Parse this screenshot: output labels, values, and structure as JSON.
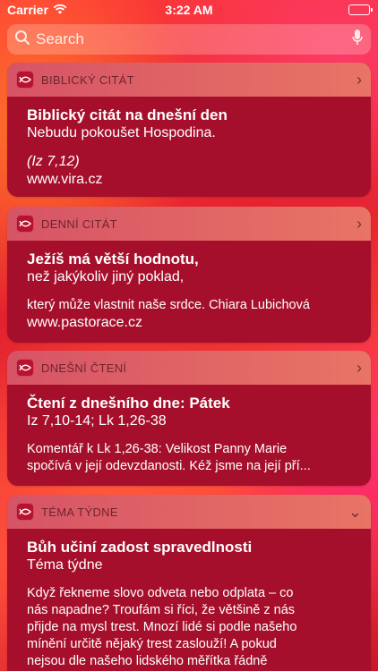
{
  "status": {
    "carrier": "Carrier",
    "time": "3:22 AM"
  },
  "search": {
    "placeholder": "Search"
  },
  "widgets": [
    {
      "title": "BIBLICKÝ CITÁT",
      "chevron": "›",
      "headline": "Biblický citát na dnešní den",
      "line1": "Nebudu pokoušet Hospodina.",
      "reference": "(Iz 7,12)",
      "source": "www.vira.cz"
    },
    {
      "title": "DENNÍ CITÁT",
      "chevron": "›",
      "headline1": "Ježíš má větší hodnotu,",
      "headline2": "než jakýkoliv jiný poklad,",
      "line1": "který může vlastnit naše srdce. Chiara Lubichová",
      "source": "www.pastorace.cz"
    },
    {
      "title": "DNEŠNÍ ČTENÍ",
      "chevron": "›",
      "headline": "Čtení z dnešního dne: Pátek",
      "line1": "Iz 7,10-14; Lk 1,26-38",
      "comment1": "Komentář k Lk 1,26-38: Velikost Panny Marie",
      "comment2": "spočívá v její odevzdanosti. Kéž jsme na její pří..."
    },
    {
      "title": "TÉMA TÝDNE",
      "chevron": "⌄",
      "headline": "Bůh učiní zadost spravedlnosti",
      "line1": "Téma týdne",
      "p1": "Když řekneme slovo odveta nebo odplata – co",
      "p2": "nás napadne? Troufám si říci, že většině z nás",
      "p3": "přijde na mysl trest. Mnozí lidé si podle našeho",
      "p4": "mínění určitě nějaký trest zaslouží! A pokud",
      "p5": "nejsou dle našeho lidského měřítka řádně"
    }
  ]
}
